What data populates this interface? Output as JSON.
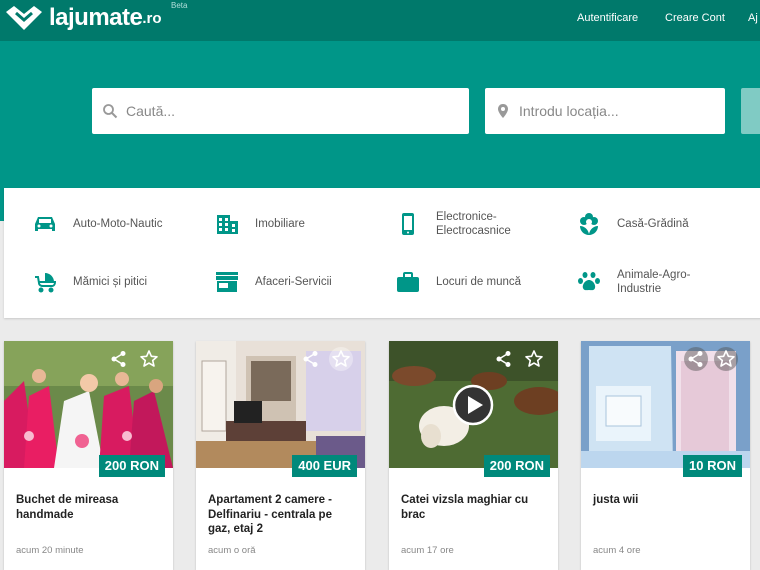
{
  "header": {
    "logo_text": "lajumate",
    "logo_tld": ".ro",
    "beta": "Beta",
    "nav": [
      "Autentificare",
      "Creare Cont",
      "Aj"
    ]
  },
  "search": {
    "query_placeholder": "Caută...",
    "location_placeholder": "Introdu locația..."
  },
  "categories": [
    {
      "label": "Auto-Moto-Nautic",
      "icon": "car-icon"
    },
    {
      "label": "Imobiliare",
      "icon": "building-icon"
    },
    {
      "label": "Electronice-\nElectrocasnice",
      "icon": "phone-icon"
    },
    {
      "label": "Casă-Grădină",
      "icon": "flower-icon"
    },
    {
      "label": "Mămici și pitici",
      "icon": "stroller-icon"
    },
    {
      "label": "Afaceri-Servicii",
      "icon": "store-icon"
    },
    {
      "label": "Locuri de muncă",
      "icon": "briefcase-icon"
    },
    {
      "label": "Animale-Agro-\nIndustrie",
      "icon": "paw-icon"
    }
  ],
  "listings": [
    {
      "title": "Buchet de mireasa handmade",
      "price": "200 RON",
      "time": "acum 20 minute"
    },
    {
      "title": "Apartament 2 camere - Delfinariu - centrala pe gaz, etaj 2",
      "price": "400 EUR",
      "time": "acum o oră"
    },
    {
      "title": "Catei vizsla maghiar cu brac",
      "price": "200 RON",
      "time": "acum 17 ore"
    },
    {
      "title": "justa wii",
      "price": "10 RON",
      "time": "acum 4 ore"
    }
  ],
  "colors": {
    "topbar": "#00796b",
    "hero": "#009688",
    "accent": "#00897b"
  }
}
